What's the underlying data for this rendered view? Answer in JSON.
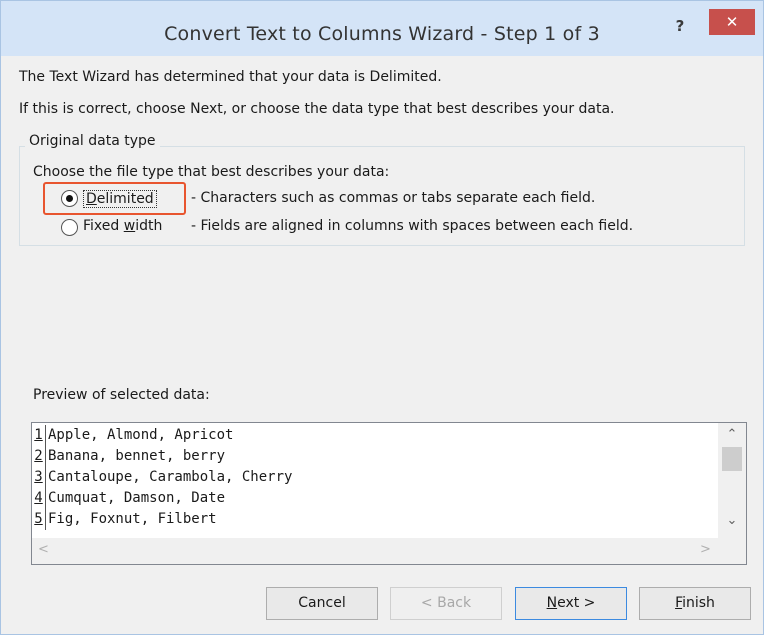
{
  "window": {
    "title": "Convert Text to Columns Wizard - Step 1 of 3",
    "help_label": "?",
    "close_label": "✕"
  },
  "intro": {
    "line1": "The Text Wizard has determined that your data is Delimited.",
    "line2": "If this is correct, choose Next, or choose the data type that best describes your data."
  },
  "original_data_type": {
    "legend": "Original data type",
    "prompt": "Choose the file type that best describes your data:",
    "options": [
      {
        "label_underlined": "D",
        "label_rest": "elimited",
        "description": "- Characters such as commas or tabs separate each field.",
        "selected": true
      },
      {
        "label_prefix": "Fixed ",
        "label_underlined": "w",
        "label_rest": "idth",
        "description": "- Fields are aligned in columns with spaces between each field.",
        "selected": false
      }
    ]
  },
  "preview": {
    "label": "Preview of selected data:",
    "rows": [
      {
        "num": "1",
        "text": "Apple, Almond, Apricot"
      },
      {
        "num": "2",
        "text": "Banana, bennet, berry"
      },
      {
        "num": "3",
        "text": "Cantaloupe, Carambola, Cherry"
      },
      {
        "num": "4",
        "text": "Cumquat, Damson, Date"
      },
      {
        "num": "5",
        "text": "Fig, Foxnut, Filbert"
      }
    ],
    "scroll_up": "⌃",
    "scroll_down": "⌄",
    "scroll_left": "<",
    "scroll_right": ">"
  },
  "buttons": {
    "cancel": "Cancel",
    "back": "< Back",
    "next_underlined": "N",
    "next_rest": "ext >",
    "finish_underlined": "F",
    "finish_rest": "inish"
  },
  "colors": {
    "titlebar": "#d4e4f7",
    "close": "#c7504c",
    "highlight": "#e8552f",
    "default_button_border": "#3c8ae0"
  }
}
